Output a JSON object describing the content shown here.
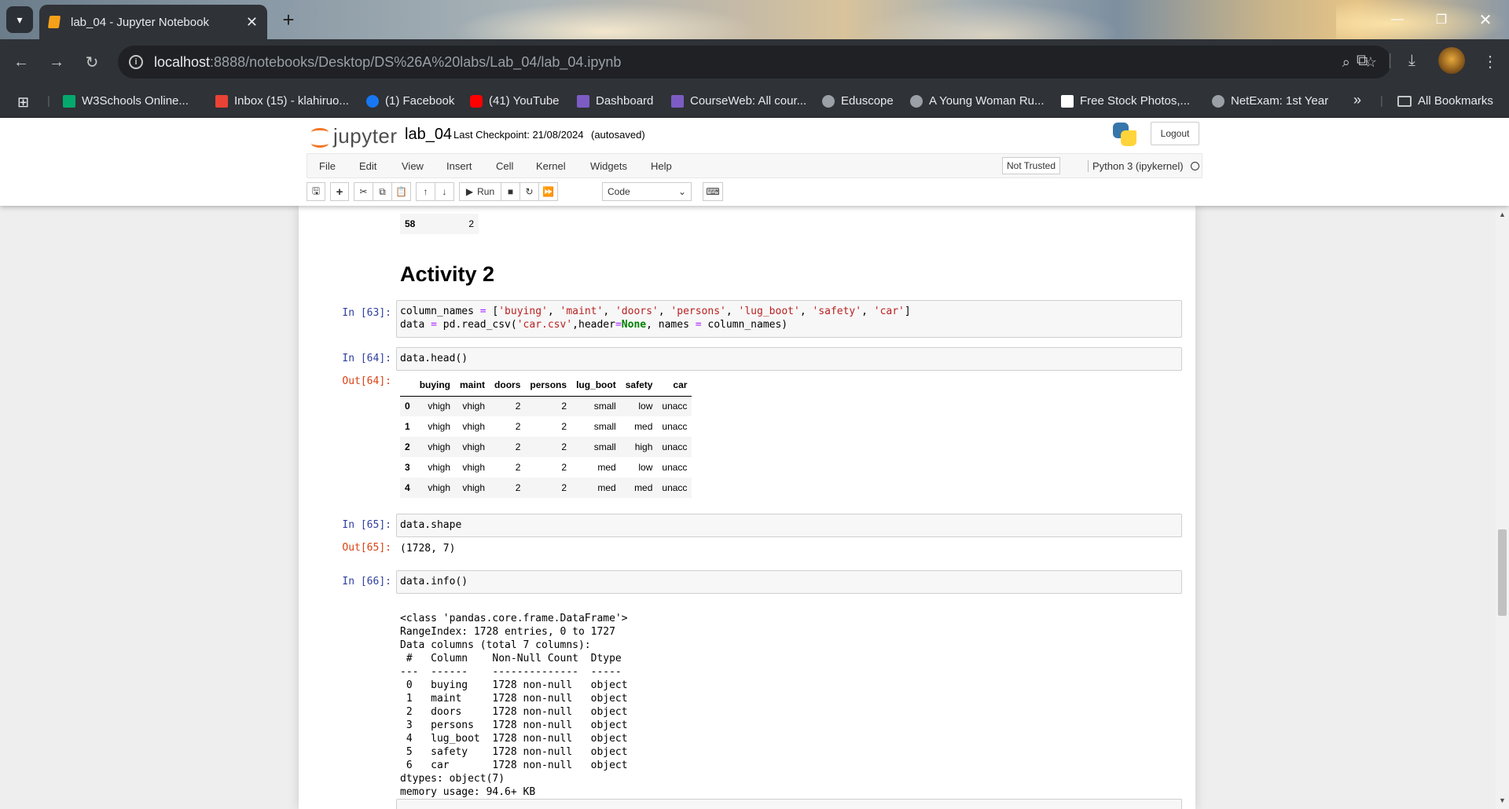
{
  "browser": {
    "tab_title": "lab_04 - Jupyter Notebook",
    "url_host": "localhost",
    "url_path": ":8888/notebooks/Desktop/DS%26A%20labs/Lab_04/lab_04.ipynb",
    "bookmarks": [
      "W3Schools Online...",
      "Inbox (15) - klahiruo...",
      "(1) Facebook",
      "(41) YouTube",
      "Dashboard",
      "CourseWeb: All cour...",
      "Eduscope",
      "A Young Woman Ru...",
      "Free Stock Photos,...",
      "NetExam: 1st Year"
    ],
    "all_bookmarks": "All Bookmarks",
    "overflow": "»"
  },
  "jupyter": {
    "logo_text": "jupyter",
    "notebook_name": "lab_04",
    "checkpoint": "Last Checkpoint: 21/08/2024",
    "autosaved": "(autosaved)",
    "logout": "Logout",
    "menu": [
      "File",
      "Edit",
      "View",
      "Insert",
      "Cell",
      "Kernel",
      "Widgets",
      "Help"
    ],
    "not_trusted": "Not Trusted",
    "kernel": "Python 3 (ipykernel)",
    "run_label": "Run",
    "cell_type": "Code"
  },
  "notebook": {
    "prev_table_last_row": {
      "index": "58",
      "value": "2"
    },
    "heading": "Activity 2",
    "cells": {
      "c63": {
        "prompt": "In [63]:"
      },
      "c64": {
        "prompt": "In [64]:",
        "code": "data.head()",
        "out_prompt": "Out[64]:"
      },
      "c65": {
        "prompt": "In [65]:",
        "code": "data.shape",
        "out_prompt": "Out[65]:",
        "output": "(1728, 7)"
      },
      "c66": {
        "prompt": "In [66]:",
        "code": "data.info()"
      }
    },
    "head_table": {
      "columns": [
        "buying",
        "maint",
        "doors",
        "persons",
        "lug_boot",
        "safety",
        "car"
      ],
      "rows": [
        {
          "index": "0",
          "values": [
            "vhigh",
            "vhigh",
            "2",
            "2",
            "small",
            "low",
            "unacc"
          ]
        },
        {
          "index": "1",
          "values": [
            "vhigh",
            "vhigh",
            "2",
            "2",
            "small",
            "med",
            "unacc"
          ]
        },
        {
          "index": "2",
          "values": [
            "vhigh",
            "vhigh",
            "2",
            "2",
            "small",
            "high",
            "unacc"
          ]
        },
        {
          "index": "3",
          "values": [
            "vhigh",
            "vhigh",
            "2",
            "2",
            "med",
            "low",
            "unacc"
          ]
        },
        {
          "index": "4",
          "values": [
            "vhigh",
            "vhigh",
            "2",
            "2",
            "med",
            "med",
            "unacc"
          ]
        }
      ]
    },
    "info_output": [
      "<class 'pandas.core.frame.DataFrame'>",
      "RangeIndex: 1728 entries, 0 to 1727",
      "Data columns (total 7 columns):",
      " #   Column    Non-Null Count  Dtype ",
      "---  ------    --------------  ----- ",
      " 0   buying    1728 non-null   object",
      " 1   maint     1728 non-null   object",
      " 2   doors     1728 non-null   object",
      " 3   persons   1728 non-null   object",
      " 4   lug_boot  1728 non-null   object",
      " 5   safety    1728 non-null   object",
      " 6   car       1728 non-null   object",
      "dtypes: object(7)",
      "memory usage: 94.6+ KB"
    ]
  },
  "colors": {
    "accent_orange": "#f37626",
    "prompt_in": "#303f9f",
    "prompt_out": "#d84315",
    "chrome_dark": "#2f3237"
  }
}
